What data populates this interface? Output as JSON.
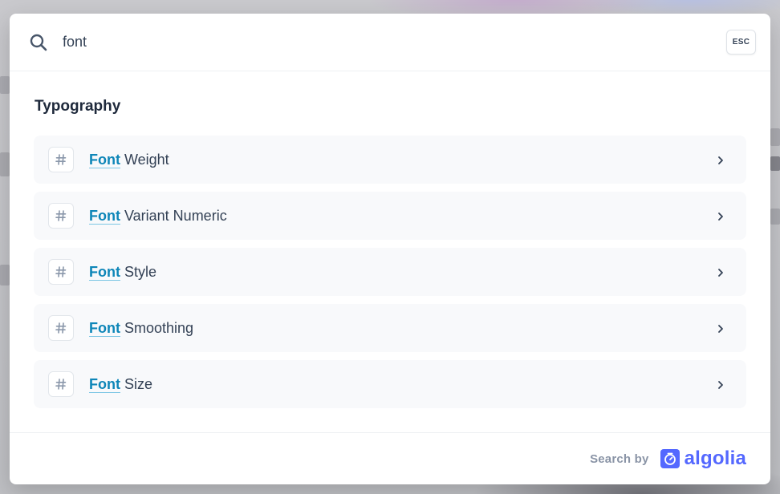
{
  "search": {
    "query": "font",
    "esc_label": "ESC"
  },
  "results": {
    "section_title": "Typography",
    "hits": [
      {
        "highlight": "Font",
        "rest": "Weight"
      },
      {
        "highlight": "Font",
        "rest": "Variant Numeric"
      },
      {
        "highlight": "Font",
        "rest": "Style"
      },
      {
        "highlight": "Font",
        "rest": "Smoothing"
      },
      {
        "highlight": "Font",
        "rest": "Size"
      }
    ],
    "hit_icon": "hash-icon",
    "action_icon": "chevron-right-icon"
  },
  "footer": {
    "search_by": "Search by",
    "brand": "algolia"
  },
  "colors": {
    "highlight": "#0e86b8",
    "brand": "#5468ff",
    "hit_bg": "#f8f9fb"
  }
}
